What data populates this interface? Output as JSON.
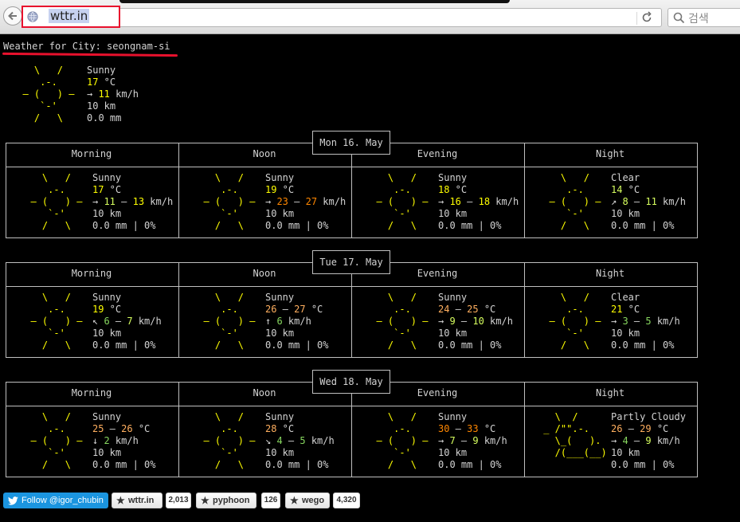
{
  "browser": {
    "url": "wttr.in",
    "search_placeholder": "검색",
    "icons": [
      "back-arrow-icon",
      "globe-icon",
      "reload-icon",
      "search-icon"
    ]
  },
  "page": {
    "header": "Weather for City: seongnam-si",
    "current": {
      "condition": "Sunny",
      "temp": "17",
      "temp_unit": " °C",
      "wind_arrow": "→ ",
      "wind": "11",
      "wind_unit": " km/h",
      "visibility": "10 km",
      "precip": "0.0 mm"
    }
  },
  "columns": [
    "Morning",
    "Noon",
    "Evening",
    "Night"
  ],
  "days": [
    {
      "date": "Mon 16. May",
      "periods": [
        {
          "cond": "Sunny",
          "t1": "17",
          "t2": "",
          "ws": "→ ",
          "w1": "11",
          "w2": "13",
          "vis": "10 km",
          "prec": "0.0 mm | 0%"
        },
        {
          "cond": "Sunny",
          "t1": "19",
          "t2": "",
          "ws": "→ ",
          "w1": "23",
          "w2": "27",
          "vis": "10 km",
          "prec": "0.0 mm | 0%"
        },
        {
          "cond": "Sunny",
          "t1": "18",
          "t2": "",
          "ws": "→ ",
          "w1": "16",
          "w2": "18",
          "vis": "10 km",
          "prec": "0.0 mm | 0%"
        },
        {
          "cond": "Clear",
          "t1": "14",
          "t2": "",
          "ws": "↗ ",
          "w1": "8",
          "w2": "11",
          "vis": "10 km",
          "prec": "0.0 mm | 0%"
        }
      ]
    },
    {
      "date": "Tue 17. May",
      "periods": [
        {
          "cond": "Sunny",
          "t1": "19",
          "t2": "",
          "ws": "↖ ",
          "w1": "6",
          "w2": "7",
          "vis": "10 km",
          "prec": "0.0 mm | 0%"
        },
        {
          "cond": "Sunny",
          "t1": "26",
          "t2": "27",
          "ws": "↑ ",
          "w1": "6",
          "w2": "",
          "vis": "10 km",
          "prec": "0.0 mm | 0%"
        },
        {
          "cond": "Sunny",
          "t1": "24",
          "t2": "25",
          "ws": "→ ",
          "w1": "9",
          "w2": "10",
          "vis": "10 km",
          "prec": "0.0 mm | 0%"
        },
        {
          "cond": "Clear",
          "t1": "21",
          "t2": "",
          "ws": "→ ",
          "w1": "3",
          "w2": "5",
          "vis": "10 km",
          "prec": "0.0 mm | 0%"
        }
      ]
    },
    {
      "date": "Wed 18. May",
      "periods": [
        {
          "cond": "Sunny",
          "t1": "25",
          "t2": "26",
          "ws": "↓ ",
          "w1": "2",
          "w2": "",
          "vis": "10 km",
          "prec": "0.0 mm | 0%"
        },
        {
          "cond": "Sunny",
          "t1": "28",
          "t2": "",
          "ws": "↘ ",
          "w1": "4",
          "w2": "5",
          "vis": "10 km",
          "prec": "0.0 mm | 0%"
        },
        {
          "cond": "Sunny",
          "t1": "30",
          "t2": "33",
          "ws": "→ ",
          "w1": "7",
          "w2": "9",
          "vis": "10 km",
          "prec": "0.0 mm | 0%"
        },
        {
          "cond": "Partly Cloudy",
          "t1": "26",
          "t2": "29",
          "ws": "→ ",
          "w1": "4",
          "w2": "9",
          "vis": "10 km",
          "prec": "0.0 mm | 0%"
        }
      ]
    }
  ],
  "units": {
    "temp": " °C",
    "wind": " km/h",
    "dash": " – "
  },
  "ascii": {
    "sun": [
      "    \\   /    ",
      "     .-.     ",
      "  ― (   ) ―  ",
      "     `-'     ",
      "    /   \\    "
    ],
    "partly_cloudy": [
      "   \\  /      ",
      " _ /\"\".-.    ",
      "   \\_(   ).  ",
      "   /(___(__) ",
      "             "
    ]
  },
  "footer": {
    "twitter_label": "Follow @igor_chubin",
    "repos": [
      {
        "name": "wttr.in",
        "stars": "2,013"
      },
      {
        "name": "pyphoon",
        "stars": "126"
      },
      {
        "name": "wego",
        "stars": "4,320"
      }
    ]
  },
  "colors": {
    "background": "#000000",
    "text": "#d3d3d3",
    "sun": "#ffff00",
    "temp_cool": "#d7ff5f",
    "temp_mild": "#ffff00",
    "temp_warm": "#ffaf5f",
    "temp_hot": "#ff8700",
    "wind_low": "#87d75f",
    "wind_mid": "#d7ff5f",
    "wind_high": "#ffff00",
    "wind_very_high": "#ff8700",
    "annotation_red": "#e8112d",
    "twitter_blue": "#1b95e0"
  }
}
